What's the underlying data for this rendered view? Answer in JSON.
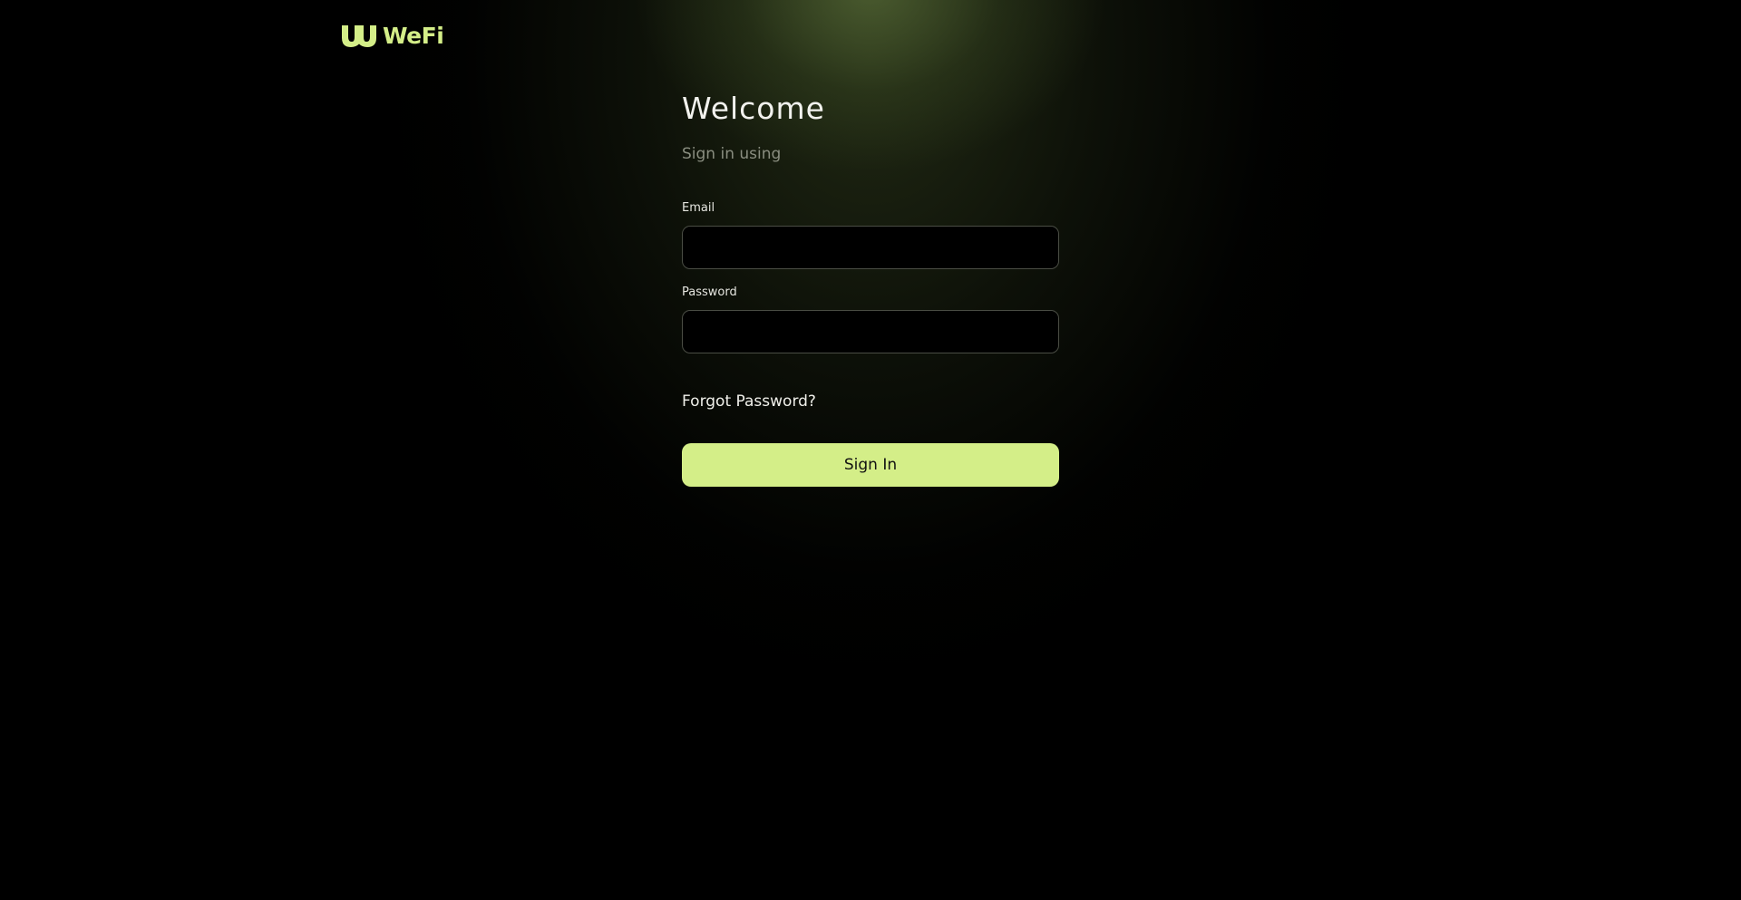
{
  "brand": {
    "name": "WeFi",
    "logo_icon": "wefi-logo-icon",
    "color": "#d4ee88"
  },
  "form": {
    "title": "Welcome",
    "subtitle": "Sign in using",
    "email": {
      "label": "Email",
      "value": "",
      "placeholder": ""
    },
    "password": {
      "label": "Password",
      "value": "",
      "placeholder": ""
    },
    "forgot_password_label": "Forgot Password?",
    "submit_label": "Sign In",
    "submit_color": "#d4ee88"
  }
}
